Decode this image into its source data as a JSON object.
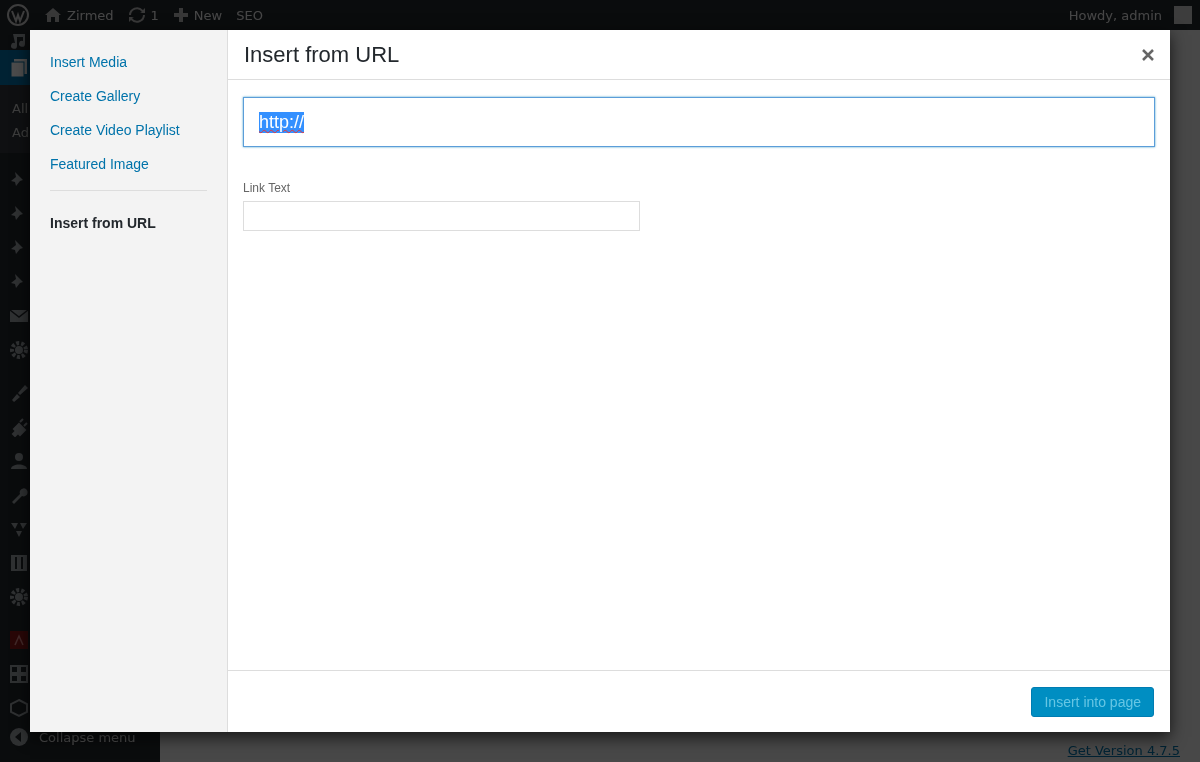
{
  "admin_bar": {
    "site_name": "Zirmed",
    "updates_count": "1",
    "new_label": "New",
    "seo_label": "SEO",
    "greeting": "Howdy, admin"
  },
  "admin_menu": {
    "submenu": [
      "All",
      "Ad"
    ],
    "collapse_label": "Collapse menu"
  },
  "footer_link": "Get Version 4.7.5",
  "modal": {
    "menu_groups": [
      [
        {
          "label": "Insert Media",
          "selected": false
        },
        {
          "label": "Create Gallery",
          "selected": false
        },
        {
          "label": "Create Video Playlist",
          "selected": false
        },
        {
          "label": "Featured Image",
          "selected": false
        }
      ],
      [
        {
          "label": "Insert from URL",
          "selected": true
        }
      ]
    ],
    "title": "Insert from URL",
    "url_field": {
      "value": "http://",
      "text_selected": true,
      "focused": true
    },
    "link_text_field": {
      "label": "Link Text"
    },
    "insert_button": {
      "label": "Insert into page",
      "disabled": true
    }
  }
}
